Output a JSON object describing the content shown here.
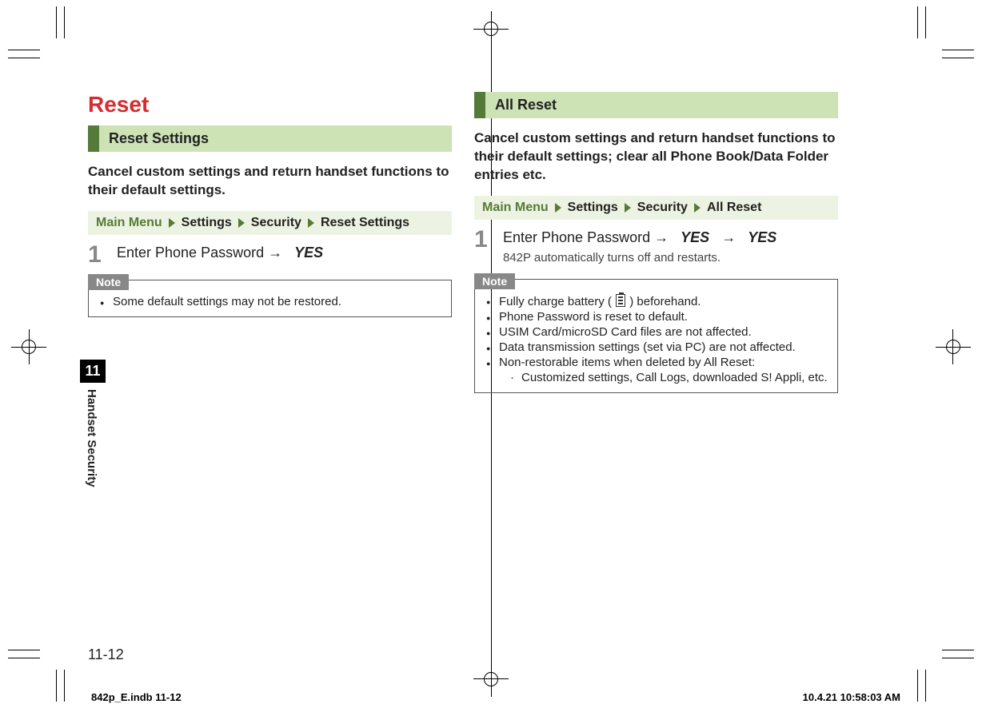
{
  "chapter": {
    "number": "11",
    "title": "Handset Security"
  },
  "page_number": "11-12",
  "footer": {
    "file": "842p_E.indb   11-12",
    "datetime": "10.4.21   10:58:03 AM"
  },
  "left": {
    "title": "Reset",
    "section_heading": "Reset Settings",
    "lead": "Cancel custom settings and return handset functions to their default settings.",
    "breadcrumb": [
      "Main Menu",
      "Settings",
      "Security",
      "Reset Settings"
    ],
    "step": {
      "number": "1",
      "text_parts": {
        "pre": "Enter Phone Password ",
        "arrow": "→",
        "yes": "YES"
      }
    },
    "note_label": "Note",
    "notes": [
      "Some default settings may not be restored."
    ]
  },
  "right": {
    "section_heading": "All Reset",
    "lead": "Cancel custom settings and return handset functions to their default settings; clear all Phone Book/Data Folder entries etc.",
    "breadcrumb": [
      "Main Menu",
      "Settings",
      "Security",
      "All Reset"
    ],
    "step": {
      "number": "1",
      "text_parts": {
        "pre": "Enter Phone Password ",
        "arrow1": "→",
        "yes1": "YES",
        "arrow2": "→",
        "yes2": "YES"
      },
      "sub": "842P automatically turns off and restarts."
    },
    "note_label": "Note",
    "notes": [
      {
        "pre": "Fully charge battery (",
        "post": ") beforehand."
      },
      "Phone Password is reset to default.",
      "USIM Card/microSD Card files are not affected.",
      "Data transmission settings (set via PC) are not affected.",
      "Non-restorable items when deleted by All Reset:"
    ],
    "sub_note": "Customized settings, Call Logs, downloaded S! Appli, etc."
  }
}
